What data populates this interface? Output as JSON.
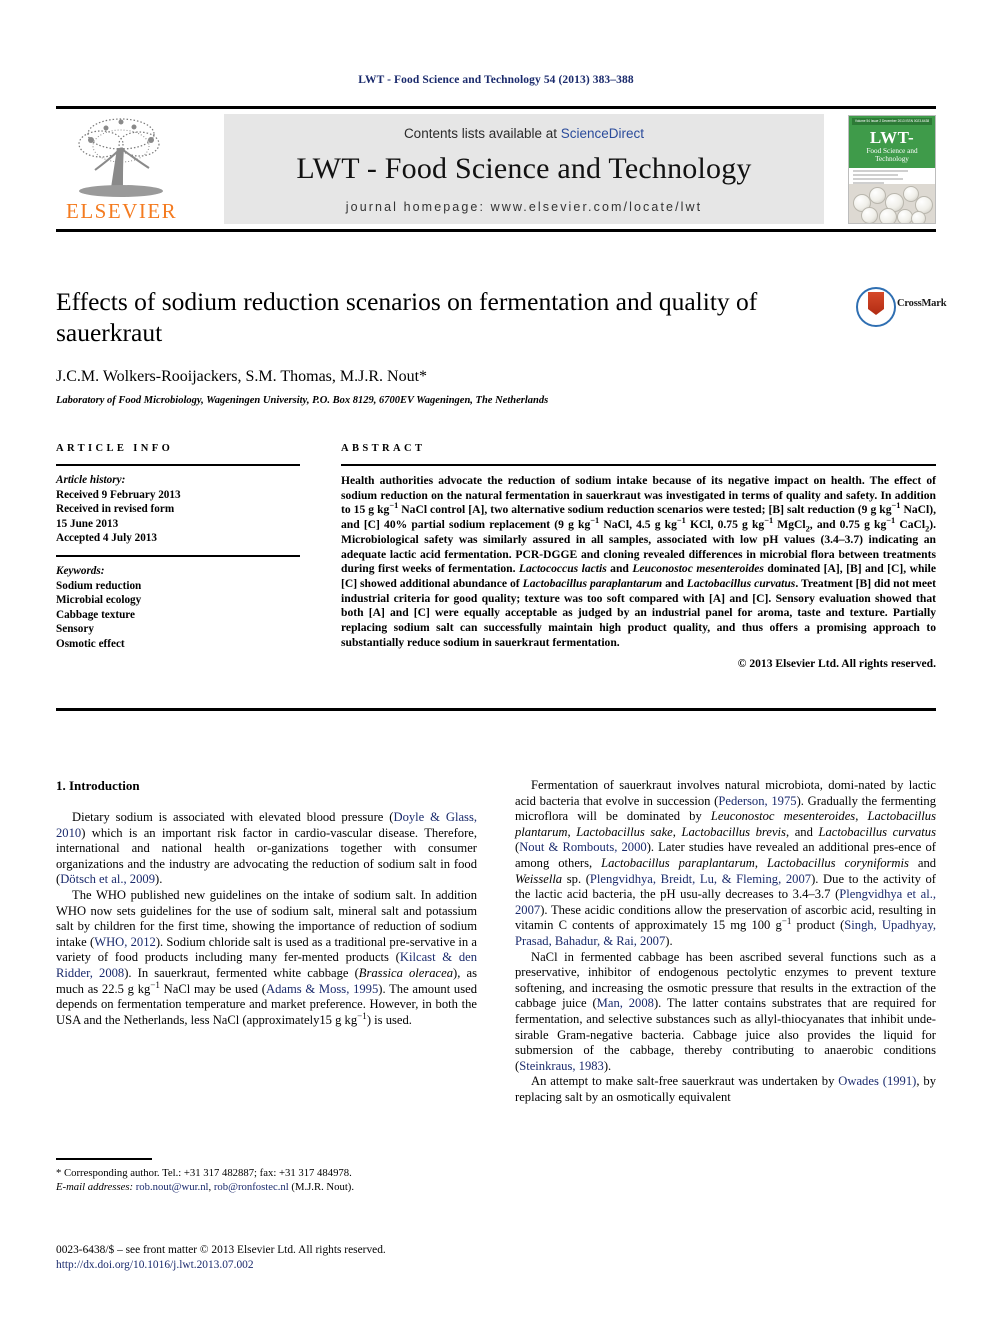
{
  "running_head": "LWT - Food Science and Technology 54 (2013) 383–388",
  "masthead": {
    "contents_prefix": "Contents lists available at ",
    "sciencedirect": "ScienceDirect",
    "journal_title": "LWT - Food Science and Technology",
    "homepage": "journal homepage: www.elsevier.com/locate/lwt",
    "publisher_word": "ELSEVIER",
    "publisher_color": "#f47b20",
    "cover": {
      "top_strip": "Volume 54  Issue 2  December 2013                         ISSN 0023-6438",
      "title": "LWT-",
      "subtitle": "Food Science and Technology",
      "line1": "Official Journal of the",
      "line2": "Swiss Society of Food Science and Technology"
    }
  },
  "article": {
    "title": "Effects of sodium reduction scenarios on fermentation and quality of sauerkraut",
    "authors": "J.C.M. Wolkers-Rooijackers, S.M. Thomas, M.J.R. Nout*",
    "affiliation": "Laboratory of Food Microbiology, Wageningen University, P.O. Box 8129, 6700EV Wageningen, The Netherlands",
    "crossmark_label": "CrossMark"
  },
  "article_info": {
    "heading": "ARTICLE INFO",
    "history_label": "Article history:",
    "history": [
      "Received 9 February 2013",
      "Received in revised form",
      "15 June 2013",
      "Accepted 4 July 2013"
    ],
    "keywords_label": "Keywords:",
    "keywords": [
      "Sodium reduction",
      "Microbial ecology",
      "Cabbage texture",
      "Sensory",
      "Osmotic effect"
    ]
  },
  "abstract": {
    "heading": "ABSTRACT",
    "copyright": "© 2013 Elsevier Ltd. All rights reserved."
  },
  "body": {
    "intro_heading": "1. Introduction"
  },
  "footnote": {
    "corresponding": "* Corresponding author. Tel.: +31 317 482887; fax: +31 317 484978.",
    "email_label": "E-mail addresses:",
    "email1": "rob.nout@wur.nl",
    "email2": "rob@ronfostec.nl",
    "email_suffix": "(M.J.R. Nout)."
  },
  "issn": {
    "line1": "0023-6438/$ – see front matter © 2013 Elsevier Ltd. All rights reserved.",
    "doi": "http://dx.doi.org/10.1016/j.lwt.2013.07.002"
  },
  "colors": {
    "link": "#1a2a6c",
    "elsevier_orange": "#f47b20",
    "cover_green": "#3f9b4a"
  }
}
